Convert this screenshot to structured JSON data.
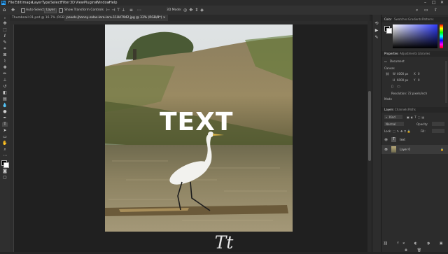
{
  "app": {
    "logo": "Ps",
    "menu": [
      "File",
      "Edit",
      "Image",
      "Layer",
      "Type",
      "Select",
      "Filter",
      "3D",
      "View",
      "Plugins",
      "Window",
      "Help"
    ],
    "window_controls": [
      "–",
      "□",
      "✕"
    ]
  },
  "options_bar": {
    "auto_select_label": "Auto-Select:",
    "auto_select_value": "Layer",
    "transform_controls_label": "Show Transform Controls",
    "mode_label": "3D Mode:"
  },
  "tabs": [
    {
      "label": "Thumbnail 01.psd @ 16.7% (RGB/8) ×",
      "active": false
    },
    {
      "label": "pexels-jhonny-salas-lera-lera-11847942.jpg @ 33% (RGB/8*) ×",
      "active": true
    }
  ],
  "canvas": {
    "overlay_text": "TEXT"
  },
  "panels": {
    "color_tabs": [
      "Color",
      "Swatches",
      "Gradients",
      "Patterns"
    ],
    "properties_tabs": [
      "Properties",
      "Adjustments",
      "Libraries"
    ],
    "properties": {
      "document_label": "Document",
      "canvas_label": "Canvas",
      "width_label": "W",
      "width_value": "4000 px",
      "height_label": "H",
      "height_value": "6000 px",
      "x_label": "X",
      "x_value": "0",
      "y_label": "Y",
      "y_value": "0",
      "resolution_label": "Resolution: 72 pixels/inch",
      "mode_label": "Mode"
    },
    "layers_tabs": [
      "Layers",
      "Channels",
      "Paths"
    ],
    "layers": {
      "kind_label": "Kind",
      "blend_mode": "Normal",
      "opacity_label": "Opacity:",
      "lock_label": "Lock:",
      "fill_label": "Fill:",
      "items": [
        {
          "name": "text",
          "type": "T"
        },
        {
          "name": "Layer 0",
          "type": "img"
        }
      ]
    }
  },
  "caption": "Tt",
  "colors": {
    "app_bg": "#252525",
    "accent": "#31a8ff",
    "foreground_swatch": "#000000",
    "background_swatch": "#ffffff"
  }
}
